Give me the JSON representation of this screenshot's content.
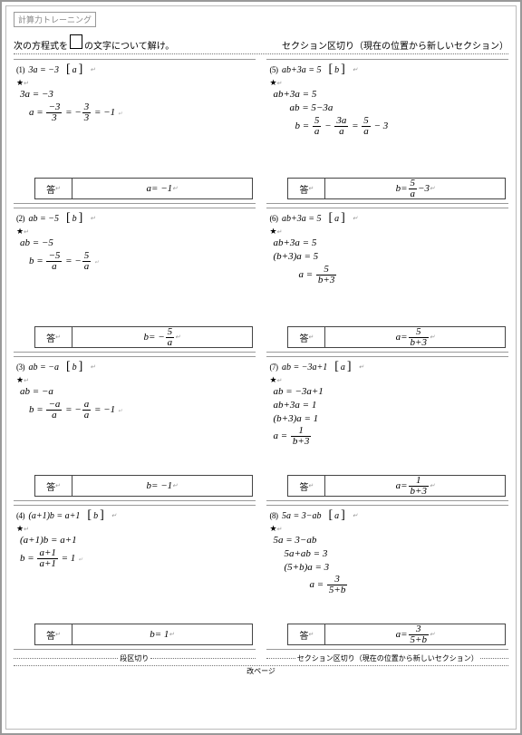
{
  "header_tag": "計算力トレーニング",
  "instruction_pre": "次の方程式を",
  "instruction_post": "の文字について解け。",
  "section_head": "セクション区切り（現在の位置から新しいセクション）",
  "answer_label": "答",
  "star": "★",
  "return": "↵",
  "dan_break": "段区切り",
  "sec_break_bottom": "セクション区切り（現在の位置から新しいセクション）",
  "page_break": "改ページ",
  "problems": [
    {
      "num": "(1)",
      "eq": "3a = −3",
      "var": "a",
      "work": [
        "3a = −3",
        "a = (−3)/3 = −(3)/3 = −1"
      ],
      "ans": "a = −1"
    },
    {
      "num": "(2)",
      "eq": "ab = −5",
      "var": "b",
      "work": [
        "ab = −5",
        "b = (−5)/a = −(5)/a"
      ],
      "ans": "b = −(5)/a"
    },
    {
      "num": "(3)",
      "eq": "ab = −a",
      "var": "b",
      "work": [
        "ab = −a",
        "b = (−a)/a = −(a)/a = −1"
      ],
      "ans": "b = −1"
    },
    {
      "num": "(4)",
      "eq": "(a+1)b = a+1",
      "var": "b",
      "work": [
        "(a+1)b = a+1",
        "b = (a+1)/(a+1) = 1"
      ],
      "ans": "b = 1"
    },
    {
      "num": "(5)",
      "eq": "ab+3a = 5",
      "var": "b",
      "work": [
        "ab+3a = 5",
        "ab = 5−3a",
        "b = 5/a − 3a/a = 5/a − 3"
      ],
      "ans": "b = (5)/a − 3"
    },
    {
      "num": "(6)",
      "eq": "ab+3a = 5",
      "var": "a",
      "work": [
        "ab+3a = 5",
        "(b+3)a = 5",
        "a = 5/(b+3)"
      ],
      "ans": "a = 5/(b+3)"
    },
    {
      "num": "(7)",
      "eq": "ab = −3a+1",
      "var": "a",
      "work": [
        "ab = −3a+1",
        "ab+3a = 1",
        "(b+3)a = 1",
        "a = 1/(b+3)"
      ],
      "ans": "a = 1/(b+3)"
    },
    {
      "num": "(8)",
      "eq": "5a = 3−ab",
      "var": "a",
      "work": [
        "5a = 3−ab",
        "5a+ab = 3",
        "(5+b)a = 3",
        "a = 3/(5+b)"
      ],
      "ans": "a = 3/(5+b)"
    }
  ]
}
